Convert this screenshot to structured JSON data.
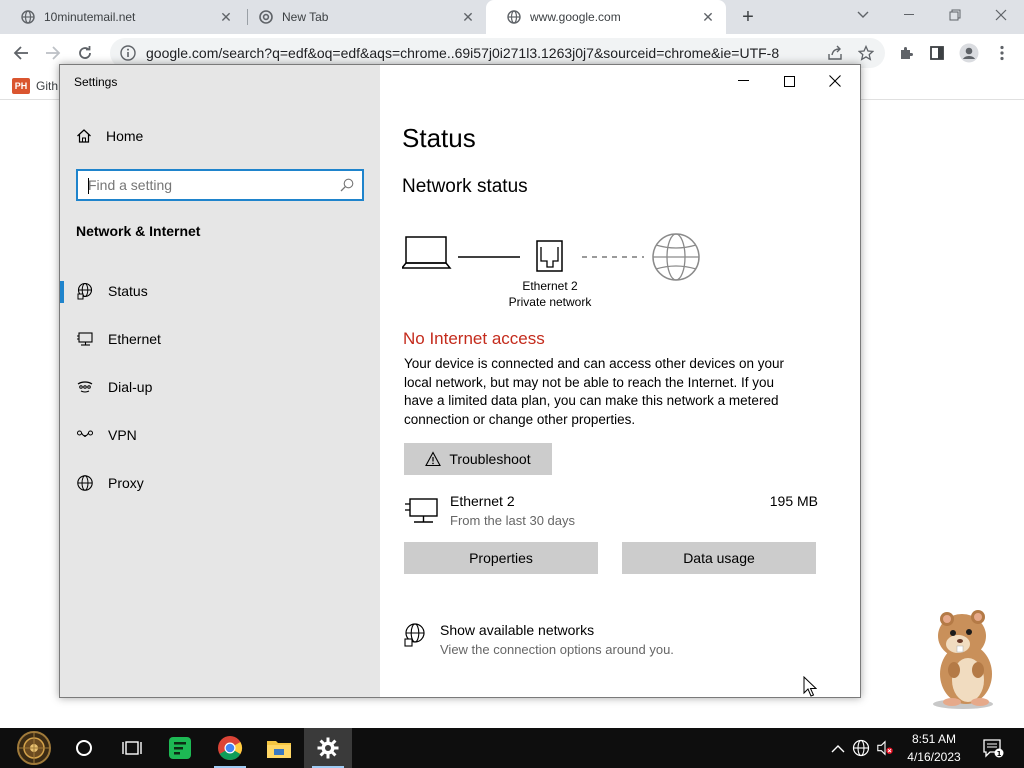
{
  "browser": {
    "tabs": [
      {
        "title": "10minutemail.net",
        "active": false
      },
      {
        "title": "New Tab",
        "active": false
      },
      {
        "title": "www.google.com",
        "active": true
      }
    ],
    "url": "google.com/search?q=edf&oq=edf&aqs=chrome..69i57j0i271l3.1263j0j7&sourceid=chrome&ie=UTF-8",
    "bookmark_label": "Gith",
    "bookmark_logo_text": "PH"
  },
  "settings": {
    "window_title": "Settings",
    "home_label": "Home",
    "search_placeholder": "Find a setting",
    "section_heading": "Network & Internet",
    "nav_items": [
      {
        "label": "Status",
        "icon": "status-globe-icon",
        "active": true
      },
      {
        "label": "Ethernet",
        "icon": "ethernet-icon",
        "active": false
      },
      {
        "label": "Dial-up",
        "icon": "dialup-icon",
        "active": false
      },
      {
        "label": "VPN",
        "icon": "vpn-icon",
        "active": false
      },
      {
        "label": "Proxy",
        "icon": "globe-icon",
        "active": false
      }
    ],
    "page_title": "Status",
    "network_status_heading": "Network status",
    "adapter_name": "Ethernet 2",
    "adapter_network": "Private network",
    "no_internet_label": "No Internet access",
    "status_description": "Your device is connected and can access other devices on your local network, but may not be able to reach the Internet. If you have a limited data plan, you can make this network a metered connection or change other properties.",
    "troubleshoot_label": "Troubleshoot",
    "adapter_row": {
      "name": "Ethernet 2",
      "subtitle": "From the last 30 days",
      "data_used": "195 MB"
    },
    "properties_label": "Properties",
    "data_usage_label": "Data usage",
    "show_networks_title": "Show available networks",
    "show_networks_subtitle": "View the connection options around you.",
    "colors": {
      "accent": "#1f84cc",
      "error": "#c42b1c",
      "sidebar_bg": "#e6e6e6",
      "button_bg": "#cccccc"
    }
  },
  "taskbar": {
    "time": "8:51 AM",
    "date": "4/16/2023",
    "pinned": [
      "start-button",
      "cortana",
      "task-view",
      "green-app",
      "chrome",
      "file-explorer",
      "settings"
    ]
  }
}
